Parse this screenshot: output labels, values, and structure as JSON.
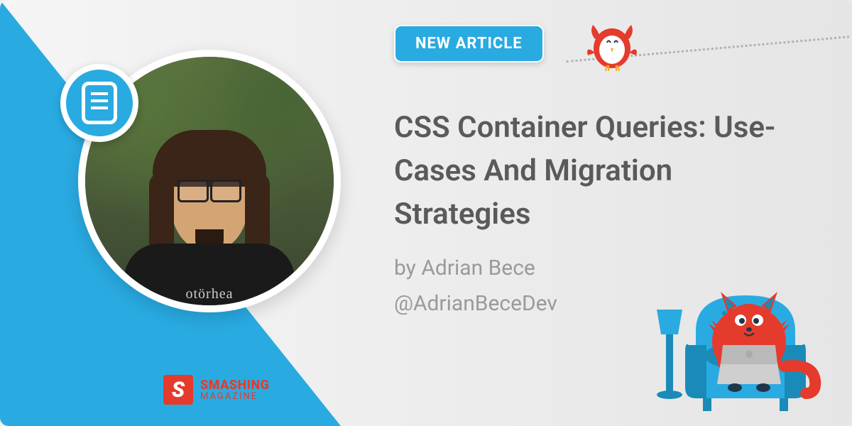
{
  "badge": {
    "label": "NEW ARTICLE"
  },
  "article": {
    "title": "CSS Container Queries: Use-Cases And Migration Strategies",
    "author_prefix": "by ",
    "author": "Adrian Bece",
    "handle": "@AdrianBeceDev"
  },
  "brand": {
    "logo_letter": "S",
    "name": "SMASHING",
    "tagline": "MAGAZINE"
  },
  "avatar": {
    "shirt_text": "otörhea"
  },
  "colors": {
    "accent": "#29abe2",
    "brand": "#e43b2c",
    "text_primary": "#5a5a5a",
    "text_secondary": "#9a9a9a"
  }
}
